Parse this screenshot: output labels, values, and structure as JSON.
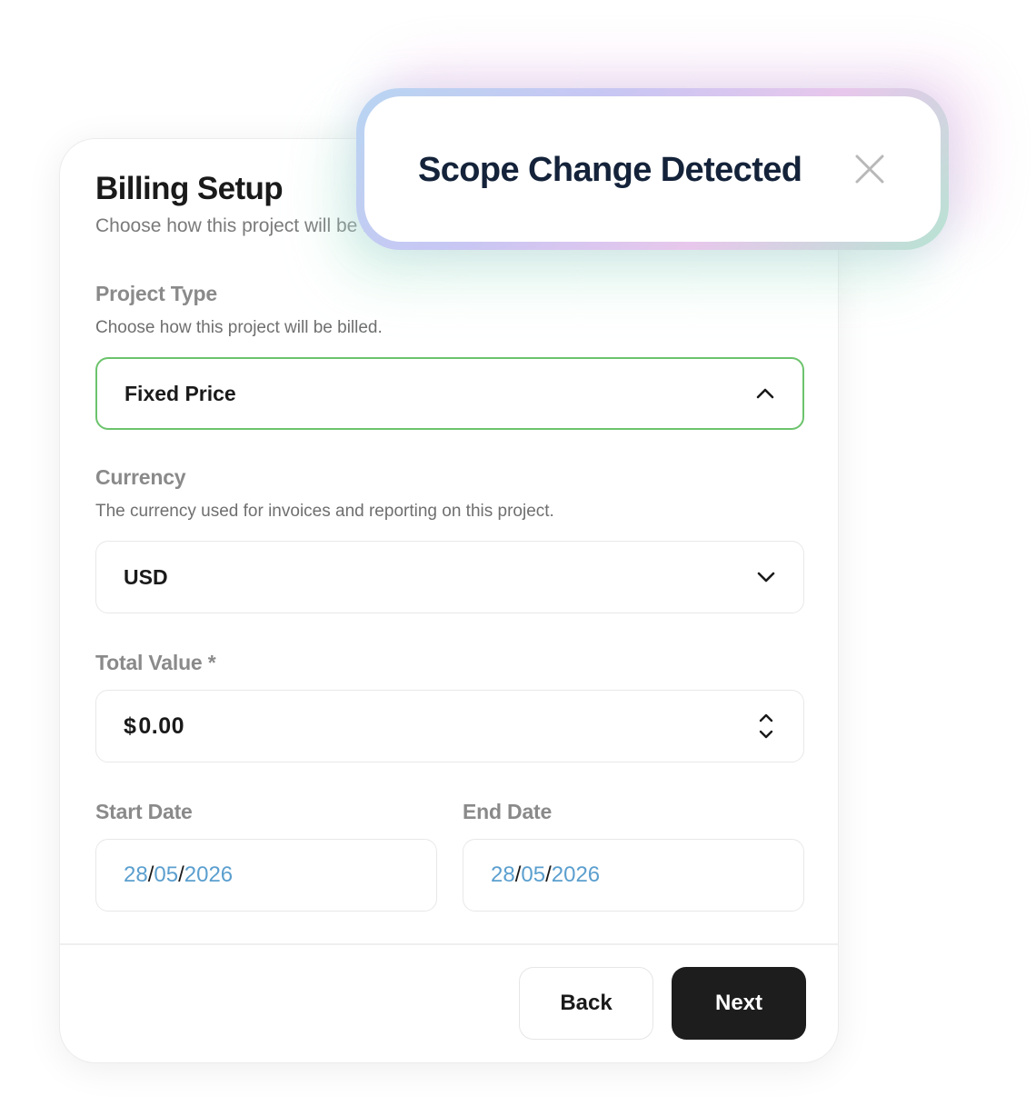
{
  "billing": {
    "title": "Billing Setup",
    "subtitle": "Choose how this project will be billed."
  },
  "project_type": {
    "label": "Project Type",
    "help": "Choose how this project will be billed.",
    "value": "Fixed Price",
    "icon": "chevron-up-icon"
  },
  "currency": {
    "label": "Currency",
    "help": "The currency used for invoices and reporting on this project.",
    "value": "USD",
    "icon": "chevron-down-icon"
  },
  "total_value": {
    "label": "Total Value *",
    "currency_symbol": "$",
    "amount": "0.00",
    "icon": "stepper-icon"
  },
  "start_date": {
    "label": "Start Date",
    "day": "28",
    "month": "05",
    "year": "2026",
    "sep": "/"
  },
  "end_date": {
    "label": "End Date",
    "day": "28",
    "month": "05",
    "year": "2026",
    "sep": "/"
  },
  "actions": {
    "back_label": "Back",
    "next_label": "Next"
  },
  "toast": {
    "title": "Scope Change Detected",
    "icon": "close-icon"
  },
  "colors": {
    "active_border": "#6cc36c",
    "date_segment": "#5b9fcf",
    "primary_button": "#1d1d1d",
    "toast_title": "#14233a"
  }
}
